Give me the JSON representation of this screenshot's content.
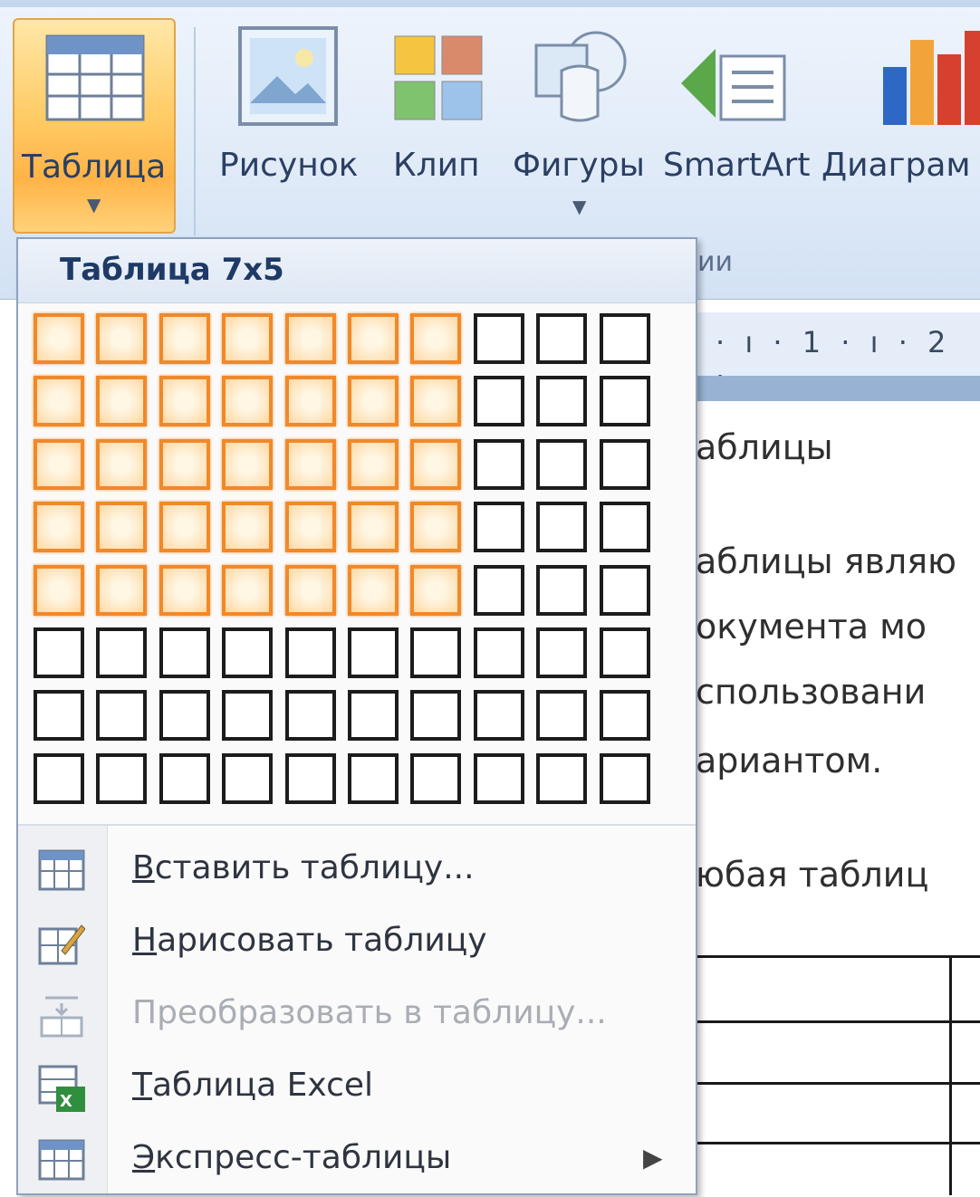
{
  "ribbon": {
    "buttons": [
      {
        "label": "Таблица",
        "icon": "table-icon"
      },
      {
        "label": "Рисунок",
        "icon": "picture-icon"
      },
      {
        "label": "Клип",
        "icon": "clip-art-icon"
      },
      {
        "label": "Фигуры",
        "icon": "shapes-icon"
      },
      {
        "label": "SmartArt",
        "icon": "smartart-icon"
      },
      {
        "label": "Диаграм",
        "icon": "chart-icon"
      }
    ],
    "group_caption": "ии"
  },
  "menu": {
    "title": "Таблица 7x5",
    "grid": {
      "columns": 10,
      "rows": 8,
      "selected_columns": 7,
      "selected_rows": 5
    },
    "items": [
      {
        "prefix": "В",
        "rest": "ставить таблицу...",
        "icon": "insert-table-icon",
        "enabled": true
      },
      {
        "prefix": "Н",
        "rest": "арисовать таблицу",
        "icon": "draw-table-icon",
        "enabled": true
      },
      {
        "prefix": "",
        "rest": "Преобразовать в таблицу...",
        "icon": "convert-to-table-icon",
        "enabled": false
      },
      {
        "prefix": "Т",
        "rest": "аблица Excel",
        "icon": "excel-table-icon",
        "enabled": true
      },
      {
        "prefix": "Э",
        "rest": "кспресс-таблицы",
        "icon": "quick-tables-icon",
        "enabled": true,
        "submenu": true
      }
    ]
  },
  "ruler": {
    "text": "· ı · 1 · ı · 2 ·"
  },
  "document": {
    "lines": [
      "аблицы",
      "аблицы являю",
      "окумента мо",
      "спользовани",
      "ариантом.",
      "юбая таблиц"
    ]
  },
  "colors": {
    "selection": "#f0892a",
    "button_active": "#ffcc66",
    "ribbon": "#dfeaf8"
  }
}
